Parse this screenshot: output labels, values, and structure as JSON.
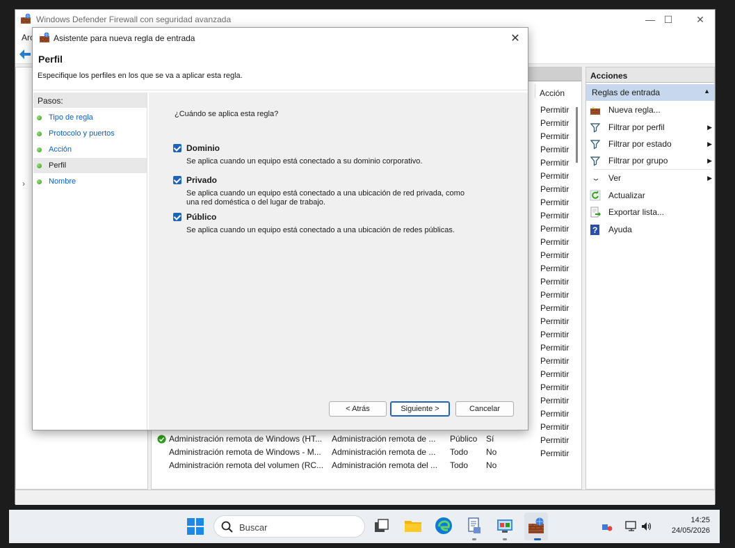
{
  "main_window": {
    "title": "Windows Defender Firewall con seguridad avanzada",
    "menu_first": "Arc",
    "controls": {
      "minimize": "—",
      "maximize": "☐",
      "close": "✕"
    }
  },
  "list": {
    "col_accion": "Acción",
    "permit_label": "Permitir",
    "permit_count": 24,
    "rows": [
      {
        "name": "Administración remota de Windows (HT...",
        "group": "Administración remota de ...",
        "profile": "Público",
        "enabled": "Sí",
        "action": "Permitir",
        "has_check": true
      },
      {
        "name": "Administración remota de Windows - M...",
        "group": "Administración remota de ...",
        "profile": "Todo",
        "enabled": "No",
        "action": "Permitir",
        "has_check": false
      },
      {
        "name": "Administración remota del volumen (RC...",
        "group": "Administración remota del ...",
        "profile": "Todo",
        "enabled": "No",
        "action": "Permitir",
        "has_check": false
      }
    ]
  },
  "actions": {
    "title": "Acciones",
    "section": "Reglas de entrada",
    "items": [
      {
        "label": "Nueva regla...",
        "icon": "new-rule-icon",
        "submenu": false
      },
      {
        "label": "Filtrar por perfil",
        "icon": "filter-icon",
        "submenu": true
      },
      {
        "label": "Filtrar por estado",
        "icon": "filter-icon",
        "submenu": true
      },
      {
        "label": "Filtrar por grupo",
        "icon": "filter-icon",
        "submenu": true
      },
      {
        "label": "Ver",
        "icon": "view-icon",
        "submenu": true
      },
      {
        "label": "Actualizar",
        "icon": "refresh-icon",
        "submenu": false
      },
      {
        "label": "Exportar lista...",
        "icon": "export-icon",
        "submenu": false
      },
      {
        "label": "Ayuda",
        "icon": "help-icon",
        "submenu": false
      }
    ]
  },
  "wizard": {
    "title": "Asistente para nueva regla de entrada",
    "header_title": "Perfil",
    "header_subtitle": "Especifique los perfiles en los que se va a aplicar esta regla.",
    "steps_title": "Pasos:",
    "steps": [
      {
        "label": "Tipo de regla",
        "current": false
      },
      {
        "label": "Protocolo y puertos",
        "current": false
      },
      {
        "label": "Acción",
        "current": false
      },
      {
        "label": "Perfil",
        "current": true
      },
      {
        "label": "Nombre",
        "current": false
      }
    ],
    "question": "¿Cuándo se aplica esta regla?",
    "options": [
      {
        "title": "Dominio",
        "checked": true,
        "desc": "Se aplica cuando un equipo está conectado a su dominio corporativo."
      },
      {
        "title": "Privado",
        "checked": true,
        "desc": "Se aplica cuando un equipo está conectado a una ubicación de red privada, como una red doméstica o del lugar de trabajo."
      },
      {
        "title": "Público",
        "checked": true,
        "desc": "Se aplica cuando un equipo está conectado a una ubicación de redes públicas."
      }
    ],
    "buttons": {
      "back": "< Atrás",
      "next": "Siguiente >",
      "cancel": "Cancelar"
    }
  },
  "taskbar": {
    "search_placeholder": "Buscar",
    "time": "14:25",
    "date": "24/05/2026"
  },
  "colors": {
    "accent": "#1f63b8",
    "section_bg": "#c7d8ee",
    "link": "#0b61c4"
  }
}
